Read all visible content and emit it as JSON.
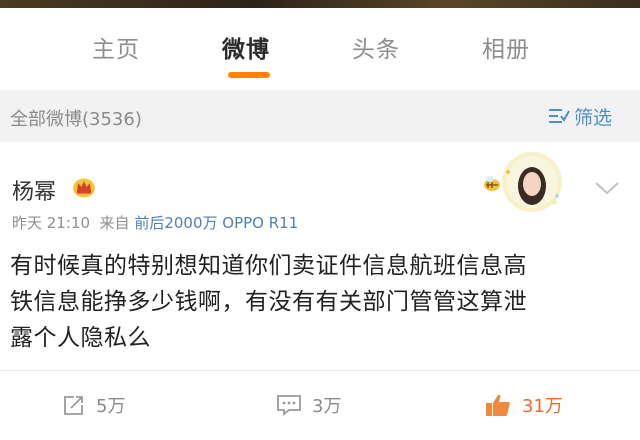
{
  "tabs": [
    {
      "label": "主页",
      "active": false
    },
    {
      "label": "微博",
      "active": true
    },
    {
      "label": "头条",
      "active": false
    },
    {
      "label": "相册",
      "active": false
    }
  ],
  "filter": {
    "label": "全部微博(3536)",
    "button_label": "筛选"
  },
  "post": {
    "username": "杨幂",
    "time": "昨天 21:10",
    "source_prefix": "来自",
    "source": "前后2000万 OPPO R11",
    "content_lines": [
      "有时候真的特别想知道你们卖证件信息航班信息高",
      "铁信息能挣多少钱啊，有没有有关部门管管这算泄",
      "露个人隐私么"
    ],
    "actions": {
      "repost": "5万",
      "comment": "3万",
      "like": "31万"
    }
  },
  "colors": {
    "accent": "#ff8200",
    "link": "#4f7fb9",
    "like": "#e76b2a"
  }
}
